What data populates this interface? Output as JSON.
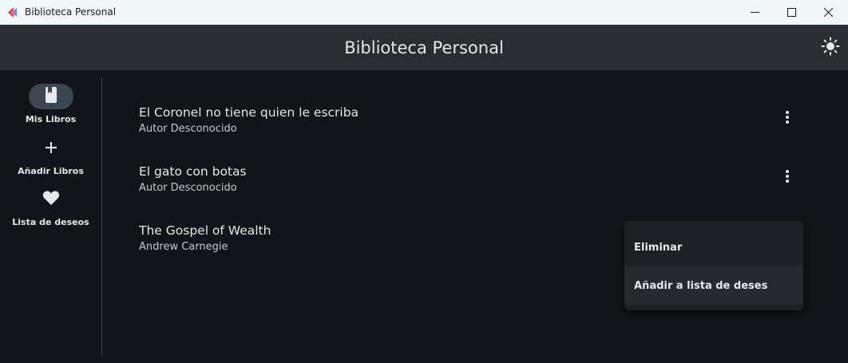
{
  "window": {
    "title": "Biblioteca Personal",
    "controls": {
      "minimize_icon": "minimize-icon",
      "maximize_icon": "maximize-icon",
      "close_icon": "close-icon"
    }
  },
  "appbar": {
    "title": "Biblioteca Personal",
    "theme_icon": "sun-icon"
  },
  "rail": {
    "items": [
      {
        "label": "Mis Libros",
        "icon": "book-icon",
        "selected": true
      },
      {
        "label": "Añadir Libros",
        "icon": "plus-icon",
        "selected": false
      },
      {
        "label": "Lista de deseos",
        "icon": "heart-icon",
        "selected": false
      }
    ]
  },
  "books": [
    {
      "title": "El Coronel no tiene quien le escriba",
      "author": "Autor Desconocido"
    },
    {
      "title": "El gato con botas",
      "author": "Autor Desconocido"
    },
    {
      "title": "The Gospel of Wealth",
      "author": "Andrew Carnegie"
    }
  ],
  "menu": {
    "items": [
      {
        "label": "Eliminar"
      },
      {
        "label": "Añadir a lista de deses"
      }
    ]
  },
  "colors": {
    "background": "#111418",
    "appbar": "#2a2d31",
    "titlebar": "#f1f7f9",
    "rail_active_pill": "#3d4752",
    "menu": "#1d2025"
  }
}
